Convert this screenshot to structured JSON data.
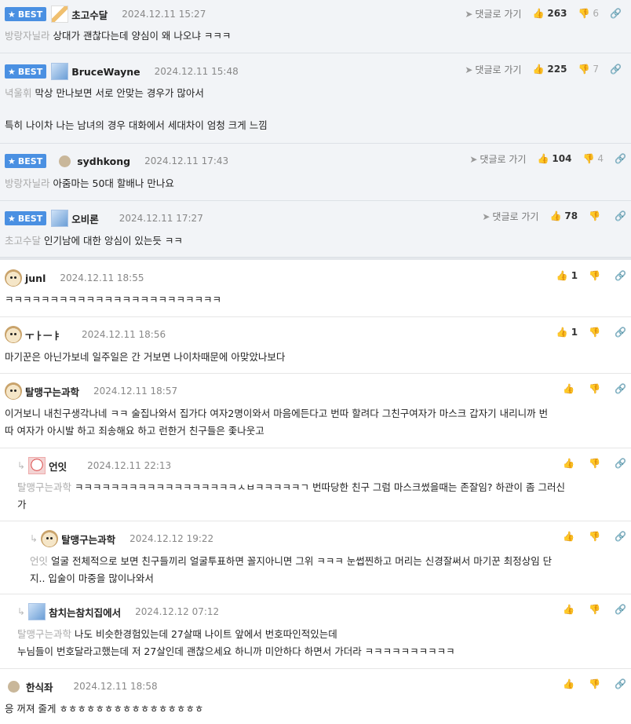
{
  "ui": {
    "best_label": "BEST",
    "reply_to_label": "댓글로 가기"
  },
  "comments": [
    {
      "nick": "초고수달",
      "date": "2024.12.11 15:27",
      "mention": "방랑자닐라",
      "text": "상대가 괜찮다는데 양심이 왜 나오냐 ㅋㅋㅋ",
      "up": "263",
      "down": "6"
    },
    {
      "nick": "BruceWayne",
      "date": "2024.12.11 15:48",
      "mention": "녁울휘",
      "text": "막상 만나보면 서로 안맞는 경우가 많아서",
      "text2": "특히 나이차 나는 남녀의 경우 대화에서 세대차이 엄청 크게 느낌",
      "up": "225",
      "down": "7"
    },
    {
      "nick": "sydhkong",
      "date": "2024.12.11 17:43",
      "mention": "방랑자닐라",
      "text": "아줌마는 50대 할배나 만나요",
      "up": "104",
      "down": "4"
    },
    {
      "nick": "오비론",
      "date": "2024.12.11 17:27",
      "mention": "초고수달",
      "text": "인기남에 대한 앙심이 있는듯 ㅋㅋ",
      "up": "78",
      "down": ""
    },
    {
      "nick": "junl",
      "date": "2024.12.11 18:55",
      "text": "ㅋㅋㅋㅋㅋㅋㅋㅋㅋㅋㅋㅋㅋㅋㅋㅋㅋㅋㅋㅋㅋㅋㅋㅋ",
      "up": "1"
    },
    {
      "nick": "ㅜㅏㅡㅑ",
      "date": "2024.12.11 18:56",
      "text": "마기꾼은 아닌가보네 일주일은 간 거보면 나이차때문에 아맞았나보다",
      "up": "1"
    },
    {
      "nick": "탈맹구는과학",
      "date": "2024.12.11 18:57",
      "text": "이거보니 내친구생각나네 ㅋㅋ 술집나와서 집가다 여자2명이와서 마음에든다고 번따 할려다 그친구여자가 마스크 갑자기 내리니까 번",
      "text2": "따 여자가 아시발 하고 죄송해요 하고 런한거 친구들은 좇나웃고",
      "up": ""
    },
    {
      "nick": "언잇",
      "date": "2024.12.11 22:13",
      "mention": "탈맹구는과학",
      "text": "ㅋㅋㅋㅋㅋㅋㅋㅋㅋㅋㅋㅋㅋㅋㅋㅋㅋㅋㅅㅂㅋㅋㅋㅋㅋㄱ 번따당한 친구 그럼 마스크썼을때는 존잘임? 하관이 좀 그러신",
      "text2": "가",
      "up": ""
    },
    {
      "nick": "탈맹구는과학",
      "date": "2024.12.12 19:22",
      "mention": "언잇",
      "text": "얼굴 전체적으로 보면 친구들끼리 얼굴투표하면 꼴지아니면 그위 ㅋㅋㅋ 눈썹찐하고 머리는 신경잘써서 마기꾼 최정상임 단",
      "text2": "지.. 입술이 마중을 많이나와서",
      "up": ""
    },
    {
      "nick": "참치는참치집에서",
      "date": "2024.12.12 07:12",
      "mention": "탈맹구는과학",
      "text": "나도 비슷한경험있는데 27살때 나이트 앞에서 번호따인적있는데",
      "text2": "누님들이 번호달라고했는데 저 27살인데 괜찮으세요 하니까 미안하다 하면서 가더라 ㅋㅋㅋㅋㅋㅋㅋㅋㅋㅋ",
      "up": ""
    },
    {
      "nick": "한식좌",
      "date": "2024.12.11 18:58",
      "text": "응 꺼져 줄게 ㅎㅎㅎㅎㅎㅎㅎㅎㅎㅎㅎㅎㅎㅎㅎㅎ",
      "up": ""
    }
  ]
}
